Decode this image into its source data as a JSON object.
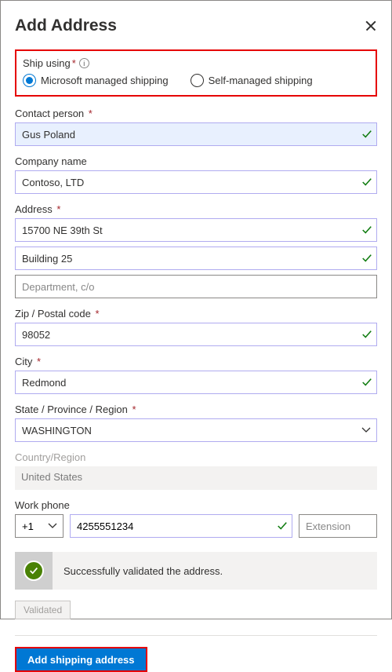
{
  "header": {
    "title": "Add Address"
  },
  "shipUsing": {
    "label": "Ship using",
    "options": [
      {
        "label": "Microsoft managed shipping",
        "selected": true
      },
      {
        "label": "Self-managed shipping",
        "selected": false
      }
    ]
  },
  "fields": {
    "contactPerson": {
      "label": "Contact person",
      "value": "Gus Poland",
      "required": true
    },
    "companyName": {
      "label": "Company name",
      "value": "Contoso, LTD",
      "required": false
    },
    "address": {
      "label": "Address",
      "required": true,
      "line1": "15700 NE 39th St",
      "line2": "Building 25",
      "line3Placeholder": "Department, c/o"
    },
    "zip": {
      "label": "Zip / Postal code",
      "value": "98052",
      "required": true
    },
    "city": {
      "label": "City",
      "value": "Redmond",
      "required": true
    },
    "state": {
      "label": "State / Province / Region",
      "value": "WASHINGTON",
      "required": true
    },
    "country": {
      "label": "Country/Region",
      "value": "United States"
    },
    "workPhone": {
      "label": "Work phone",
      "countryCode": "+1",
      "number": "4255551234",
      "extensionPlaceholder": "Extension"
    }
  },
  "validation": {
    "message": "Successfully validated the address."
  },
  "buttons": {
    "validated": "Validated",
    "addShipping": "Add shipping address"
  }
}
